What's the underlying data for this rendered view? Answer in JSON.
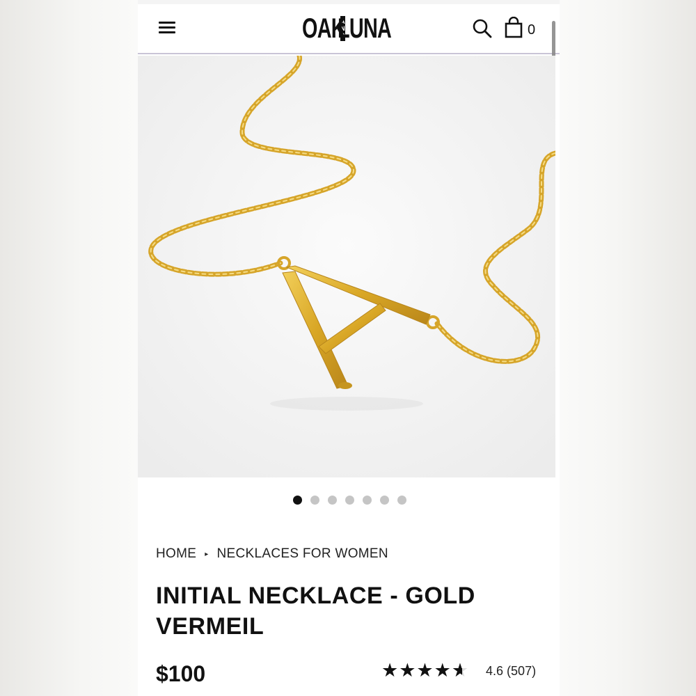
{
  "header": {
    "logo": {
      "word1": "OAK",
      "middle_top": "A",
      "middle_mid": "N",
      "middle_bot": "D",
      "word2": "LUNA"
    },
    "cart_count": "0",
    "icons": {
      "menu": "menu-icon",
      "search": "search-icon",
      "cart": "shopping-bag-icon"
    }
  },
  "gallery": {
    "image": "gold-initial-a-necklace",
    "slide_count": 7,
    "active_slide": 1
  },
  "breadcrumb": {
    "items": [
      "HOME",
      "NECKLACES FOR WOMEN"
    ],
    "separator": "▸"
  },
  "product": {
    "title": "INITIAL NECKLACE - GOLD VERMEIL",
    "price": "$100",
    "rating_value": 4.6,
    "rating_text": "4.6 (507)",
    "stars": "★★★★★"
  },
  "colors": {
    "gold": "#d9a726",
    "text": "#111111",
    "divider": "#c9c4d6"
  }
}
